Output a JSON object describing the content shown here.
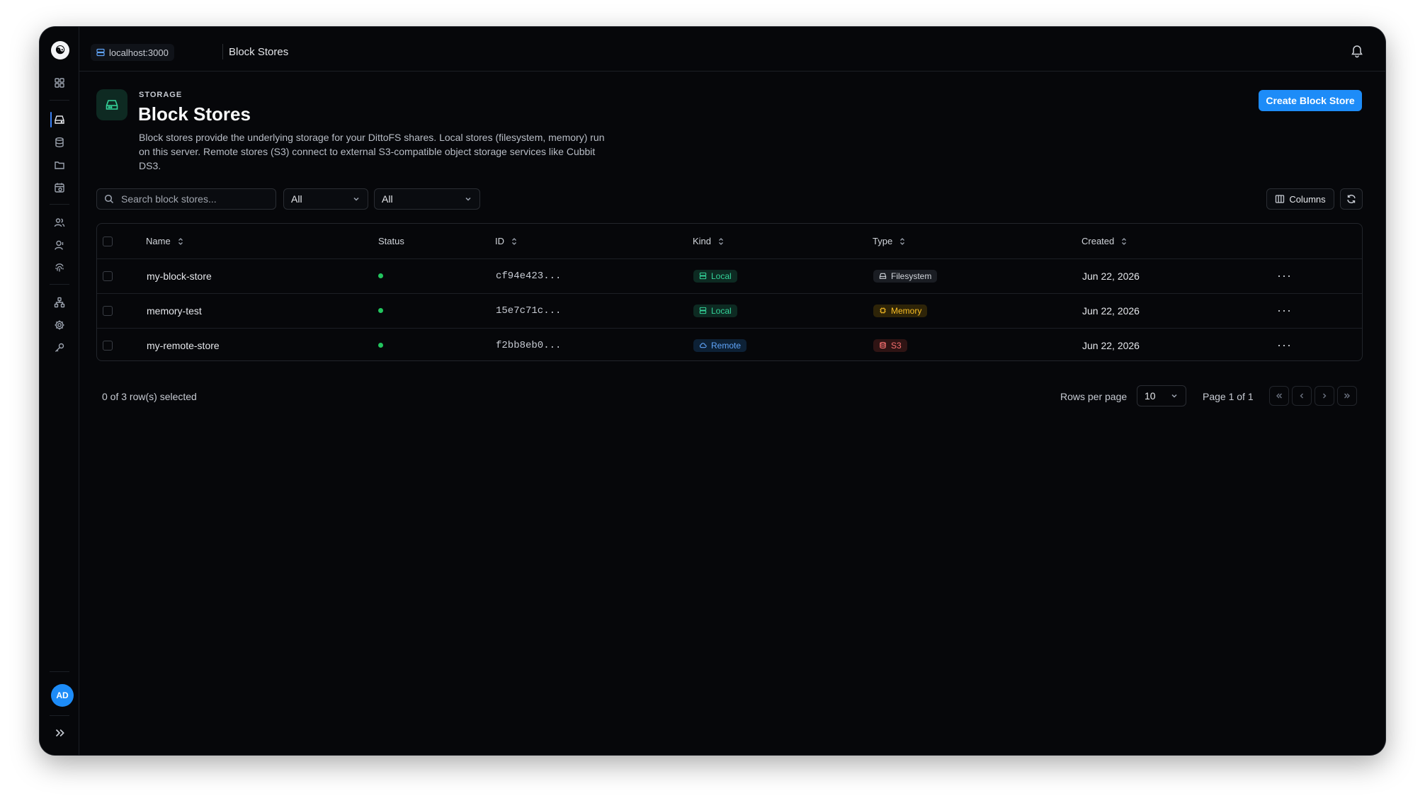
{
  "app": {
    "logo_glyph": "☯",
    "user_initials": "AD"
  },
  "topbar": {
    "host": "localhost:3000",
    "breadcrumb": "Block Stores"
  },
  "header": {
    "eyebrow": "STORAGE",
    "title": "Block Stores",
    "description": "Block stores provide the underlying storage for your DittoFS shares. Local stores (filesystem, memory) run on this server. Remote stores (S3) connect to external S3-compatible object storage services like Cubbit DS3.",
    "create_label": "Create Block Store"
  },
  "toolbar": {
    "search_placeholder": "Search block stores...",
    "filter_kind": "All",
    "filter_type": "All",
    "columns_label": "Columns"
  },
  "table": {
    "columns": {
      "name": "Name",
      "status": "Status",
      "id": "ID",
      "kind": "Kind",
      "type": "Type",
      "created": "Created"
    },
    "rows": [
      {
        "name": "my-block-store",
        "id": "cf94e423...",
        "kind": "Local",
        "type": "Filesystem",
        "created": "Jun 22, 2026"
      },
      {
        "name": "memory-test",
        "id": "15e7c71c...",
        "kind": "Local",
        "type": "Memory",
        "created": "Jun 22, 2026"
      },
      {
        "name": "my-remote-store",
        "id": "f2bb8eb0...",
        "kind": "Remote",
        "type": "S3",
        "created": "Jun 22, 2026"
      }
    ]
  },
  "footer": {
    "selection": "0 of 3 row(s) selected",
    "rows_per_page_label": "Rows per page",
    "rows_per_page": "10",
    "page": "Page 1 of 1"
  },
  "colors": {
    "accent": "#1d8cf8",
    "status_ok": "#22c55e",
    "local": "#34d399",
    "remote": "#60a5fa",
    "memory": "#fbbf24",
    "s3": "#f87171"
  },
  "icons": {
    "sidebar": [
      "dashboard-icon",
      "hard-drive-icon",
      "database-icon",
      "folder-icon",
      "calendar-clock-icon",
      "users-icon",
      "user-icon",
      "fingerprint-icon",
      "network-icon",
      "gear-icon",
      "key-icon"
    ]
  }
}
